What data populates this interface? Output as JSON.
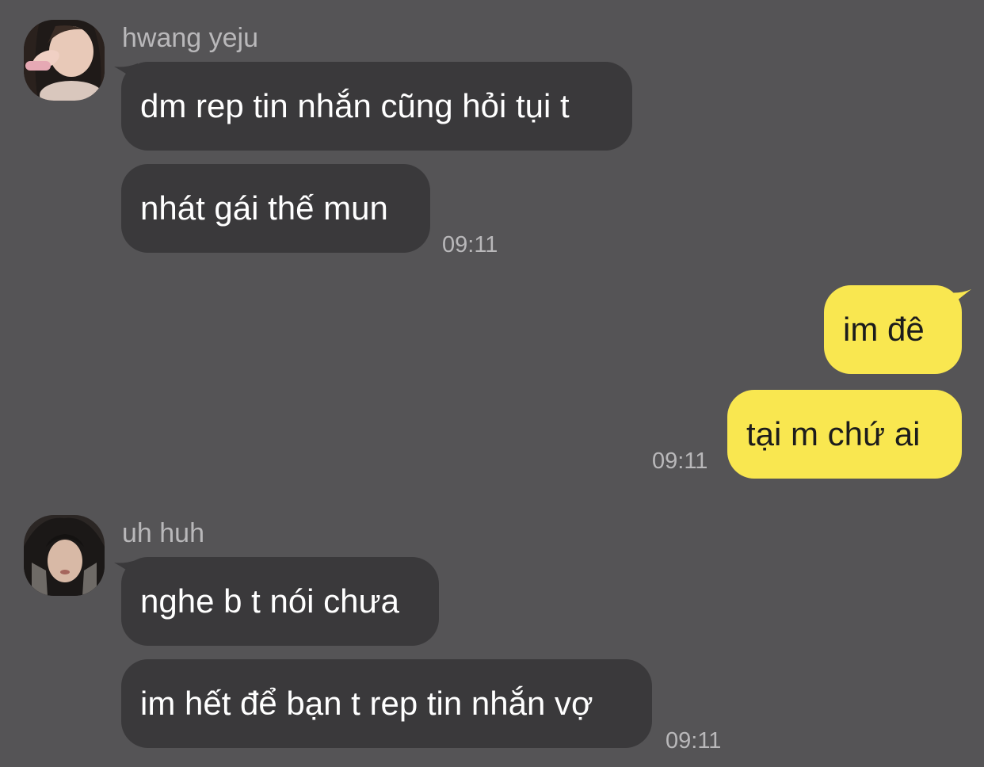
{
  "colors": {
    "background": "#555456",
    "incoming_bubble": "#3a393b",
    "outgoing_bubble": "#f9e750",
    "meta_text": "#b9b8ba"
  },
  "messages": {
    "group1": {
      "sender": "hwang yeju",
      "avatar_icon": "profile-photo",
      "msg1": "dm rep tin nhắn cũng hỏi tụi t",
      "msg2": "nhát gái thế mun",
      "time": "09:11"
    },
    "group2": {
      "msg1": "im đê",
      "msg2": "tại m chứ ai",
      "time": "09:11"
    },
    "group3": {
      "sender": "uh huh",
      "avatar_icon": "profile-photo",
      "msg1": "nghe b t nói chưa",
      "msg2": "im hết để bạn t rep tin nhắn vợ",
      "time": "09:11"
    }
  }
}
